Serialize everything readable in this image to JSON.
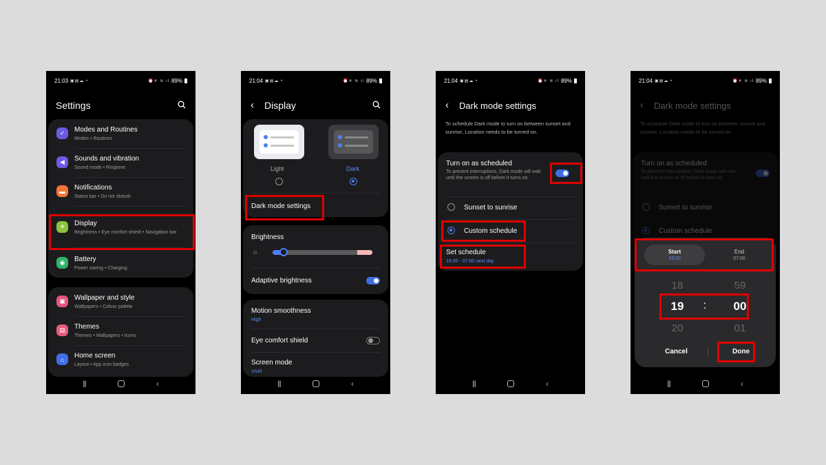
{
  "status": {
    "time1": "21:03",
    "time2": "21:04",
    "battery": "89%"
  },
  "phone1": {
    "title": "Settings",
    "items": [
      {
        "title": "Modes and Routines",
        "sub": "Modes • Routines",
        "color": "#6a5be0"
      },
      {
        "title": "Sounds and vibration",
        "sub": "Sound mode • Ringtone",
        "color": "#6d5ae6"
      },
      {
        "title": "Notifications",
        "sub": "Status bar • Do not disturb",
        "color": "#f0763a"
      },
      {
        "title": "Display",
        "sub": "Brightness • Eye comfort shield • Navigation bar",
        "color": "#8ac43d"
      },
      {
        "title": "Battery",
        "sub": "Power saving • Charging",
        "color": "#2fb36b"
      },
      {
        "title": "Wallpaper and style",
        "sub": "Wallpapers • Colour palette",
        "color": "#e6557d"
      },
      {
        "title": "Themes",
        "sub": "Themes • Wallpapers • Icons",
        "color": "#e65a7a"
      },
      {
        "title": "Home screen",
        "sub": "Layout • App icon badges",
        "color": "#3f6ee6"
      }
    ]
  },
  "phone2": {
    "title": "Display",
    "light_label": "Light",
    "dark_label": "Dark",
    "dark_mode_settings": "Dark mode settings",
    "brightness": "Brightness",
    "brightness_level": 0.07,
    "adaptive_brightness": "Adaptive brightness",
    "motion_smoothness": "Motion smoothness",
    "motion_value": "High",
    "eye_comfort": "Eye comfort shield",
    "screen_mode": "Screen mode",
    "screen_value": "Vivid"
  },
  "phone3": {
    "title": "Dark mode settings",
    "desc": "To schedule Dark mode to turn on between sunset and sunrise, Location needs to be turned on.",
    "turn_on": "Turn on as scheduled",
    "turn_on_sub": "To prevent interruptions, Dark mode will wait until the screen is off before it turns on.",
    "sunset": "Sunset to sunrise",
    "custom": "Custom schedule",
    "set_schedule": "Set schedule",
    "schedule_value": "19:00 - 07:00 next day"
  },
  "phone4": {
    "start": "Start",
    "start_time": "19:00",
    "end": "End",
    "end_time": "07:00",
    "hour_prev": "18",
    "hour": "19",
    "hour_next": "20",
    "min_prev": "59",
    "min": "00",
    "min_next": "01",
    "colon": ":",
    "cancel": "Cancel",
    "done": "Done"
  }
}
